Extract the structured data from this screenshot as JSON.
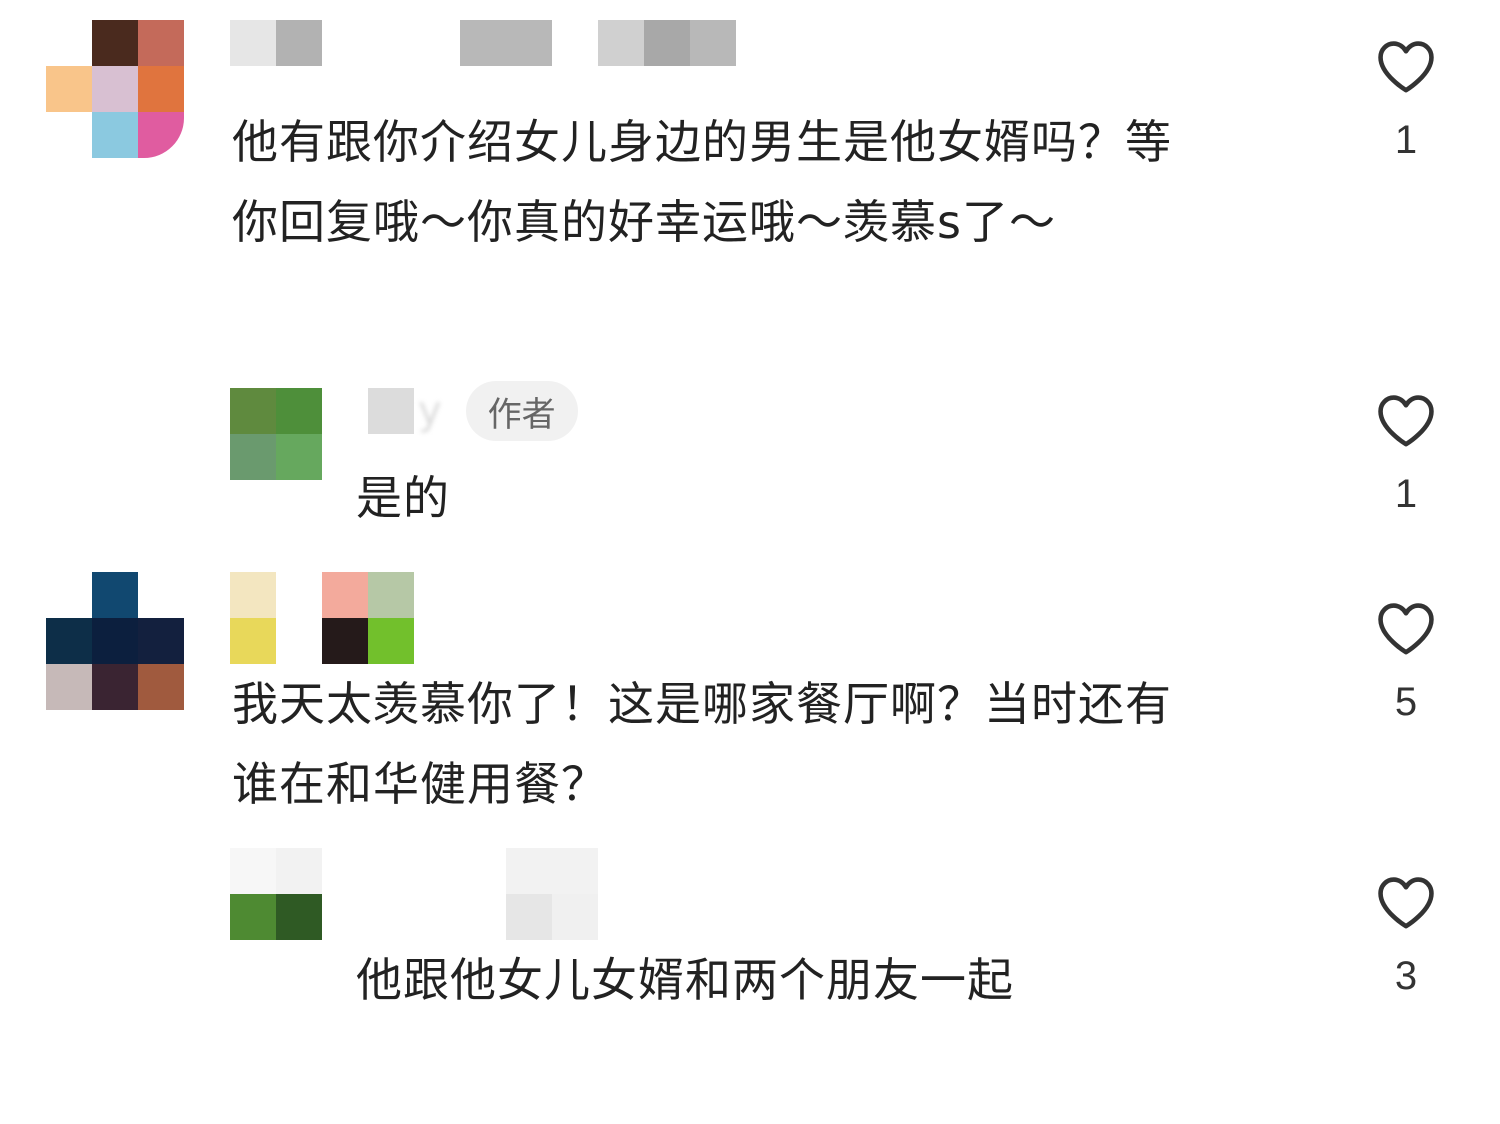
{
  "comments": [
    {
      "username": "",
      "text_lines": [
        "他有跟你介绍女儿身边的男生是他女婿吗？等",
        "你回复哦～你真的好幸运哦～羡慕s了～"
      ],
      "likes": "1"
    },
    {
      "username": "y",
      "badge": "作者",
      "text_lines": [
        "是的"
      ],
      "likes": "1"
    },
    {
      "username": "",
      "text_lines": [
        "我天太羡慕你了！这是哪家餐厅啊？当时还有",
        "谁在和华健用餐？"
      ],
      "likes": "5"
    },
    {
      "username": "",
      "text_lines": [
        "他跟他女儿女婿和两个朋友一起"
      ],
      "likes": "3"
    }
  ],
  "icons": {
    "like": "heart-outline-icon"
  },
  "colors": {
    "text": "#222222",
    "badge_bg": "#f1f1f1",
    "badge_text": "#666666",
    "heart_stroke": "#333333"
  }
}
